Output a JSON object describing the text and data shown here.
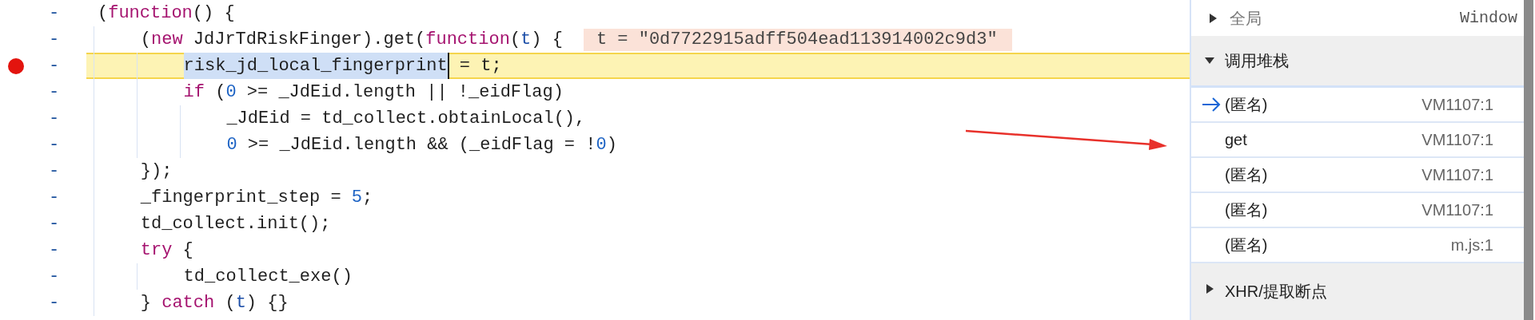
{
  "editor": {
    "lines": [
      {
        "gutter": "-",
        "breakpoint": false,
        "current": false,
        "tokens": [
          {
            "kind": "plain",
            "text": "("
          },
          {
            "kind": "keyword",
            "text": "function"
          },
          {
            "kind": "plain",
            "text": "() {"
          }
        ]
      },
      {
        "gutter": "-",
        "breakpoint": false,
        "current": false,
        "inline_value": "t = \"0d7722915adff504ead113914002c9d3\"",
        "tokens": [
          {
            "kind": "plain",
            "text": "    ("
          },
          {
            "kind": "keyword",
            "text": "new"
          },
          {
            "kind": "plain",
            "text": " JdJrTdRiskFinger).get("
          },
          {
            "kind": "keyword",
            "text": "function"
          },
          {
            "kind": "plain",
            "text": "("
          },
          {
            "kind": "param",
            "text": "t"
          },
          {
            "kind": "plain",
            "text": ") {"
          }
        ]
      },
      {
        "gutter": "-",
        "breakpoint": true,
        "current": true,
        "tokens": [
          {
            "kind": "plain",
            "text": "        risk_jd_local_fingerprint",
            "selected": true
          },
          {
            "kind": "plain",
            "text": " = t;"
          }
        ]
      },
      {
        "gutter": "-",
        "breakpoint": false,
        "current": false,
        "tokens": [
          {
            "kind": "keyword",
            "text": "        if"
          },
          {
            "kind": "plain",
            "text": " ("
          },
          {
            "kind": "number",
            "text": "0"
          },
          {
            "kind": "plain",
            "text": " >= _JdEid.length || !_eidFlag)"
          }
        ]
      },
      {
        "gutter": "-",
        "breakpoint": false,
        "current": false,
        "tokens": [
          {
            "kind": "plain",
            "text": "            _JdEid = td_collect.obtainLocal(),"
          }
        ]
      },
      {
        "gutter": "-",
        "breakpoint": false,
        "current": false,
        "tokens": [
          {
            "kind": "number",
            "text": "            0"
          },
          {
            "kind": "plain",
            "text": " >= _JdEid.length && (_eidFlag = !"
          },
          {
            "kind": "number",
            "text": "0"
          },
          {
            "kind": "plain",
            "text": ")"
          }
        ]
      },
      {
        "gutter": "-",
        "breakpoint": false,
        "current": false,
        "tokens": [
          {
            "kind": "plain",
            "text": "    });"
          }
        ]
      },
      {
        "gutter": "-",
        "breakpoint": false,
        "current": false,
        "tokens": [
          {
            "kind": "plain",
            "text": "    _fingerprint_step = "
          },
          {
            "kind": "number",
            "text": "5"
          },
          {
            "kind": "plain",
            "text": ";"
          }
        ]
      },
      {
        "gutter": "-",
        "breakpoint": false,
        "current": false,
        "tokens": [
          {
            "kind": "plain",
            "text": "    td_collect.init();"
          }
        ]
      },
      {
        "gutter": "-",
        "breakpoint": false,
        "current": false,
        "tokens": [
          {
            "kind": "keyword",
            "text": "    try"
          },
          {
            "kind": "plain",
            "text": " {"
          }
        ]
      },
      {
        "gutter": "-",
        "breakpoint": false,
        "current": false,
        "tokens": [
          {
            "kind": "plain",
            "text": "        td_collect_exe()"
          }
        ]
      },
      {
        "gutter": "-",
        "breakpoint": false,
        "current": false,
        "tokens": [
          {
            "kind": "plain",
            "text": "    } "
          },
          {
            "kind": "keyword",
            "text": "catch"
          },
          {
            "kind": "plain",
            "text": " ("
          },
          {
            "kind": "param",
            "text": "t"
          },
          {
            "kind": "plain",
            "text": ") {}"
          }
        ]
      }
    ]
  },
  "debugger": {
    "scope_item": {
      "name": "全局",
      "expanded": false,
      "value": "Window"
    },
    "call_stack": {
      "title": "调用堆栈",
      "expanded": true,
      "frames": [
        {
          "name": "(匿名)",
          "location": "VM1107:1",
          "selected": true
        },
        {
          "name": "get",
          "location": "VM1107:1",
          "selected": false
        },
        {
          "name": "(匿名)",
          "location": "VM1107:1",
          "selected": false
        },
        {
          "name": "(匿名)",
          "location": "VM1107:1",
          "selected": false
        },
        {
          "name": "(匿名)",
          "location": "m.js:1",
          "selected": false
        }
      ]
    },
    "xhr_breakpoints": {
      "title": "XHR/提取断点",
      "expanded": false
    }
  }
}
